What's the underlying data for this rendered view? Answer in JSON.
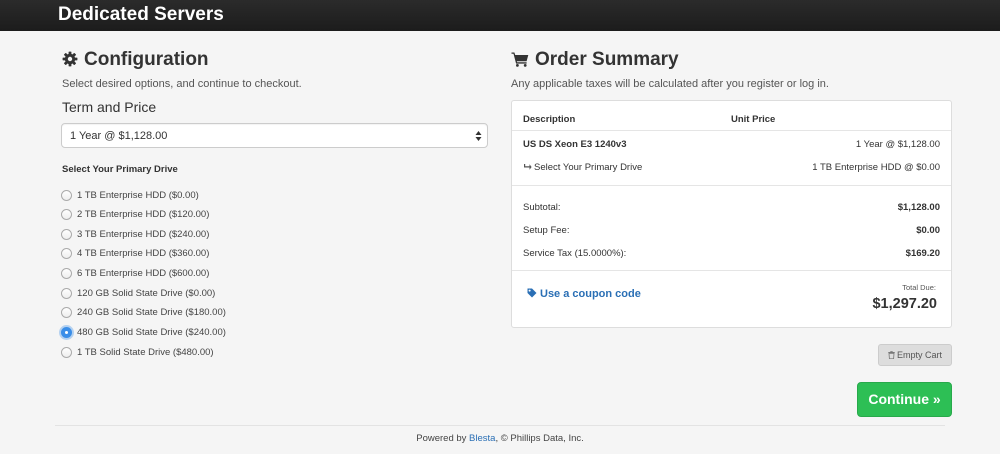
{
  "header": {
    "title": "Dedicated Servers"
  },
  "configuration": {
    "heading": "Configuration",
    "icon": "gear-icon",
    "subtitle": "Select desired options, and continue to checkout.",
    "term_label": "Term and Price",
    "term_value": "1 Year @ $1,128.00",
    "drive_label": "Select Your Primary Drive",
    "drives": [
      {
        "label": "1 TB Enterprise HDD ($0.00)",
        "checked": false
      },
      {
        "label": "2 TB Enterprise HDD ($120.00)",
        "checked": false
      },
      {
        "label": "3 TB Enterprise HDD ($240.00)",
        "checked": false
      },
      {
        "label": "4 TB Enterprise HDD ($360.00)",
        "checked": false
      },
      {
        "label": "6 TB Enterprise HDD ($600.00)",
        "checked": false
      },
      {
        "label": "120 GB Solid State Drive ($0.00)",
        "checked": false
      },
      {
        "label": "240 GB Solid State Drive ($180.00)",
        "checked": false
      },
      {
        "label": "480 GB Solid State Drive ($240.00)",
        "checked": true
      },
      {
        "label": "1 TB Solid State Drive ($480.00)",
        "checked": false
      }
    ]
  },
  "summary": {
    "heading": "Order Summary",
    "icon": "cart-icon",
    "subtitle": "Any applicable taxes will be calculated after you register or log in.",
    "col_description": "Description",
    "col_unit_price": "Unit Price",
    "item_name": "US DS Xeon E3 1240v3",
    "item_price": "1 Year @ $1,128.00",
    "option_name": "Select Your Primary Drive",
    "option_price": "1 TB Enterprise HDD @ $0.00",
    "subtotal_label": "Subtotal:",
    "subtotal_value": "$1,128.00",
    "setup_label": "Setup Fee:",
    "setup_value": "$0.00",
    "tax_label": "Service Tax (15.0000%):",
    "tax_value": "$169.20",
    "coupon_label": "Use a coupon code",
    "total_label": "Total Due:",
    "total_value": "$1,297.20",
    "empty_cart_label": "Empty Cart",
    "continue_label": "Continue »"
  },
  "footer": {
    "prefix": "Powered by ",
    "link": "Blesta",
    "suffix": ", © Phillips Data, Inc."
  },
  "colors": {
    "accent_green": "#2dbf55",
    "link_blue": "#2a6fb5",
    "radio_checked": "#3b8ee8"
  }
}
